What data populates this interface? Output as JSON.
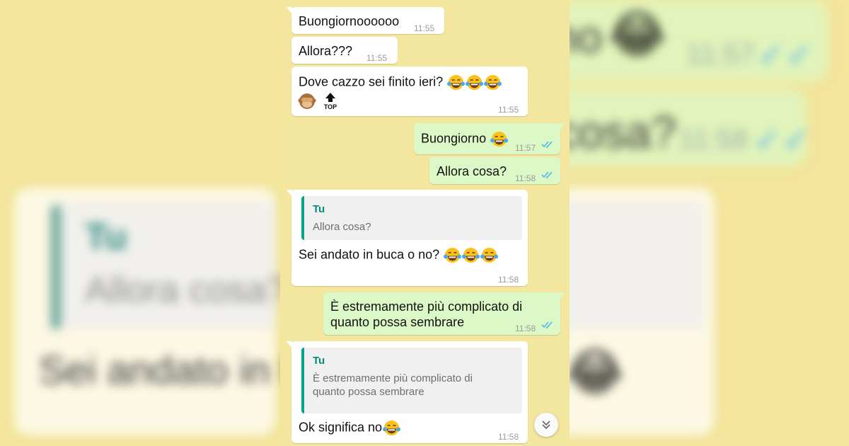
{
  "background": {
    "bg_text_1": "no",
    "bg_text_2": "cosa?",
    "bg_time_1": "11:57",
    "bg_time_2": "11:58",
    "bg_quote_author": "Tu",
    "bg_quote_text": "Allora cosa?",
    "bg_message": "Sei andato in buca o no?"
  },
  "colors": {
    "chat_background": "#f3e79f",
    "incoming_bubble": "#ffffff",
    "outgoing_bubble": "#dcf8c6",
    "quote_accent": "#06a490",
    "read_ticks": "#4fb6ec"
  },
  "messages": [
    {
      "direction": "incoming",
      "text": "Buongiornoooooo",
      "time": "11:55"
    },
    {
      "direction": "incoming",
      "text": "Allora???",
      "time": "11:55"
    },
    {
      "direction": "incoming",
      "text": "Dove cazzo sei finito ieri?",
      "emoji": [
        "face-with-tears-of-joy-icon",
        "face-with-tears-of-joy-icon",
        "face-with-tears-of-joy-icon"
      ],
      "second_line_emoji": [
        "see-no-evil-monkey-icon",
        "top-arrow-icon"
      ],
      "time": "11:55"
    },
    {
      "direction": "outgoing",
      "text": "Buongiorno",
      "emoji": [
        "face-with-tears-of-joy-icon"
      ],
      "time": "11:57",
      "status": "read"
    },
    {
      "direction": "outgoing",
      "text": "Allora cosa?",
      "time": "11:58",
      "status": "read"
    },
    {
      "direction": "incoming",
      "quote_author": "Tu",
      "quote_text": "Allora cosa?",
      "text": "Sei andato in buca o no?",
      "emoji": [
        "face-with-tears-of-joy-icon",
        "face-with-tears-of-joy-icon",
        "face-with-tears-of-joy-icon"
      ],
      "time": "11:58"
    },
    {
      "direction": "outgoing",
      "text_line1": "È estremamente più complicato di",
      "text_line2": "quanto possa sembrare",
      "time": "11:58",
      "status": "read"
    },
    {
      "direction": "incoming",
      "quote_author": "Tu",
      "quote_text": "È estremamente più complicato di quanto possa sembrare",
      "text": "Ok significa no",
      "emoji": [
        "face-with-tears-of-joy-icon"
      ],
      "time": "11:58"
    }
  ],
  "top_label": "TOP",
  "scroll_button": "chevron-double-down-icon"
}
